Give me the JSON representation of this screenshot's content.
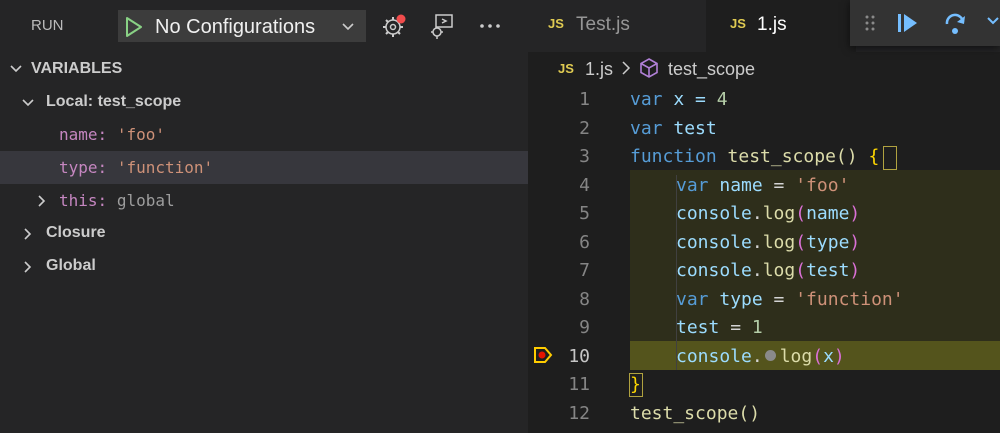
{
  "sidebar": {
    "run_label": "RUN",
    "config_select": "No Configurations",
    "section_title": "VARIABLES",
    "scopes": {
      "local": "Local: test_scope",
      "closure": "Closure",
      "global": "Global"
    },
    "vars": {
      "name_key": "name:",
      "name_val": "'foo'",
      "type_key": "type:",
      "type_val": "'function'",
      "this_key": "this:",
      "this_val": "global"
    }
  },
  "tabs": [
    {
      "icon_text": "JS",
      "label": "Test.js"
    },
    {
      "icon_text": "JS",
      "label": "1.js"
    }
  ],
  "breadcrumb": {
    "icon_text": "JS",
    "file": "1.js",
    "symbol": "test_scope"
  },
  "code": {
    "line_numbers": [
      "1",
      "2",
      "3",
      "4",
      "5",
      "6",
      "7",
      "8",
      "9",
      "10",
      "11",
      "12"
    ],
    "l1": {
      "kw": "var",
      "rest": " x = ",
      "num": "4"
    },
    "l2": {
      "kw": "var",
      "var": " test"
    },
    "l3": {
      "kw": "function",
      "fn": " test_scope",
      "paren": "() ",
      "brace": "{"
    },
    "l4": {
      "kw": "var",
      "var": " name",
      "eq": " = ",
      "str": "'foo'"
    },
    "l5": {
      "obj": "console",
      "dot": ".",
      "fn": "log",
      "lp": "(",
      "arg": "name",
      "rp": ")"
    },
    "l6": {
      "obj": "console",
      "dot": ".",
      "fn": "log",
      "lp": "(",
      "arg": "type",
      "rp": ")"
    },
    "l7": {
      "obj": "console",
      "dot": ".",
      "fn": "log",
      "lp": "(",
      "arg": "test",
      "rp": ")"
    },
    "l8": {
      "kw": "var",
      "var": " type",
      "eq": " = ",
      "str": "'function'"
    },
    "l9": {
      "var": "test",
      "eq": " = ",
      "num": "1"
    },
    "l10": {
      "obj": "console",
      "dot": ".",
      "fn": "log",
      "lp": "(",
      "arg": "x",
      "rp": ")"
    },
    "l11": {
      "brace": "}"
    },
    "l12": {
      "fn": "test_scope",
      "paren": "()"
    }
  },
  "colors": {
    "accent_play": "#89d185",
    "breakpoint": "#e51400",
    "debug_arrow": "#ffcc00",
    "debug_icon": "#75beff"
  }
}
